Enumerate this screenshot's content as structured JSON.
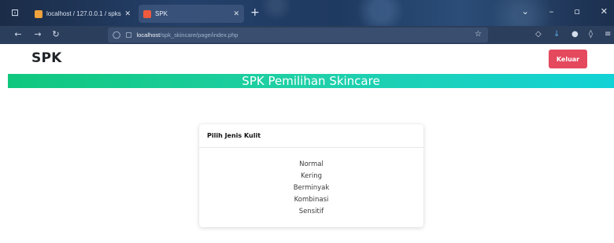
{
  "browser": {
    "tabs": [
      {
        "title": "localhost / 127.0.0.1 / spkskin",
        "active": false
      },
      {
        "title": "SPK",
        "active": true
      }
    ],
    "url": {
      "host": "localhost",
      "path": "/spk_skincare/page/index.php"
    },
    "icons": {
      "menu": "tab-list-icon",
      "new_tab": "plus-icon",
      "back": "arrow-left-icon",
      "forward": "arrow-right-icon",
      "reload": "reload-icon",
      "bookmark": "star-icon",
      "pocket": "pocket-icon",
      "downloads": "download-icon",
      "account": "account-icon",
      "extensions": "extension-icon",
      "app_menu": "hamburger-icon"
    }
  },
  "page": {
    "brand": "SPK",
    "logout_label": "Keluar",
    "banner_title": "SPK Pemilihan Skincare",
    "card": {
      "title": "Pilih Jenis Kulit",
      "options": [
        "Normal",
        "Kering",
        "Berminyak",
        "Kombinasi",
        "Sensitif"
      ]
    }
  },
  "colors": {
    "logout_button": "#e4495e",
    "banner_start": "#10c77e",
    "banner_end": "#12d2d6"
  }
}
